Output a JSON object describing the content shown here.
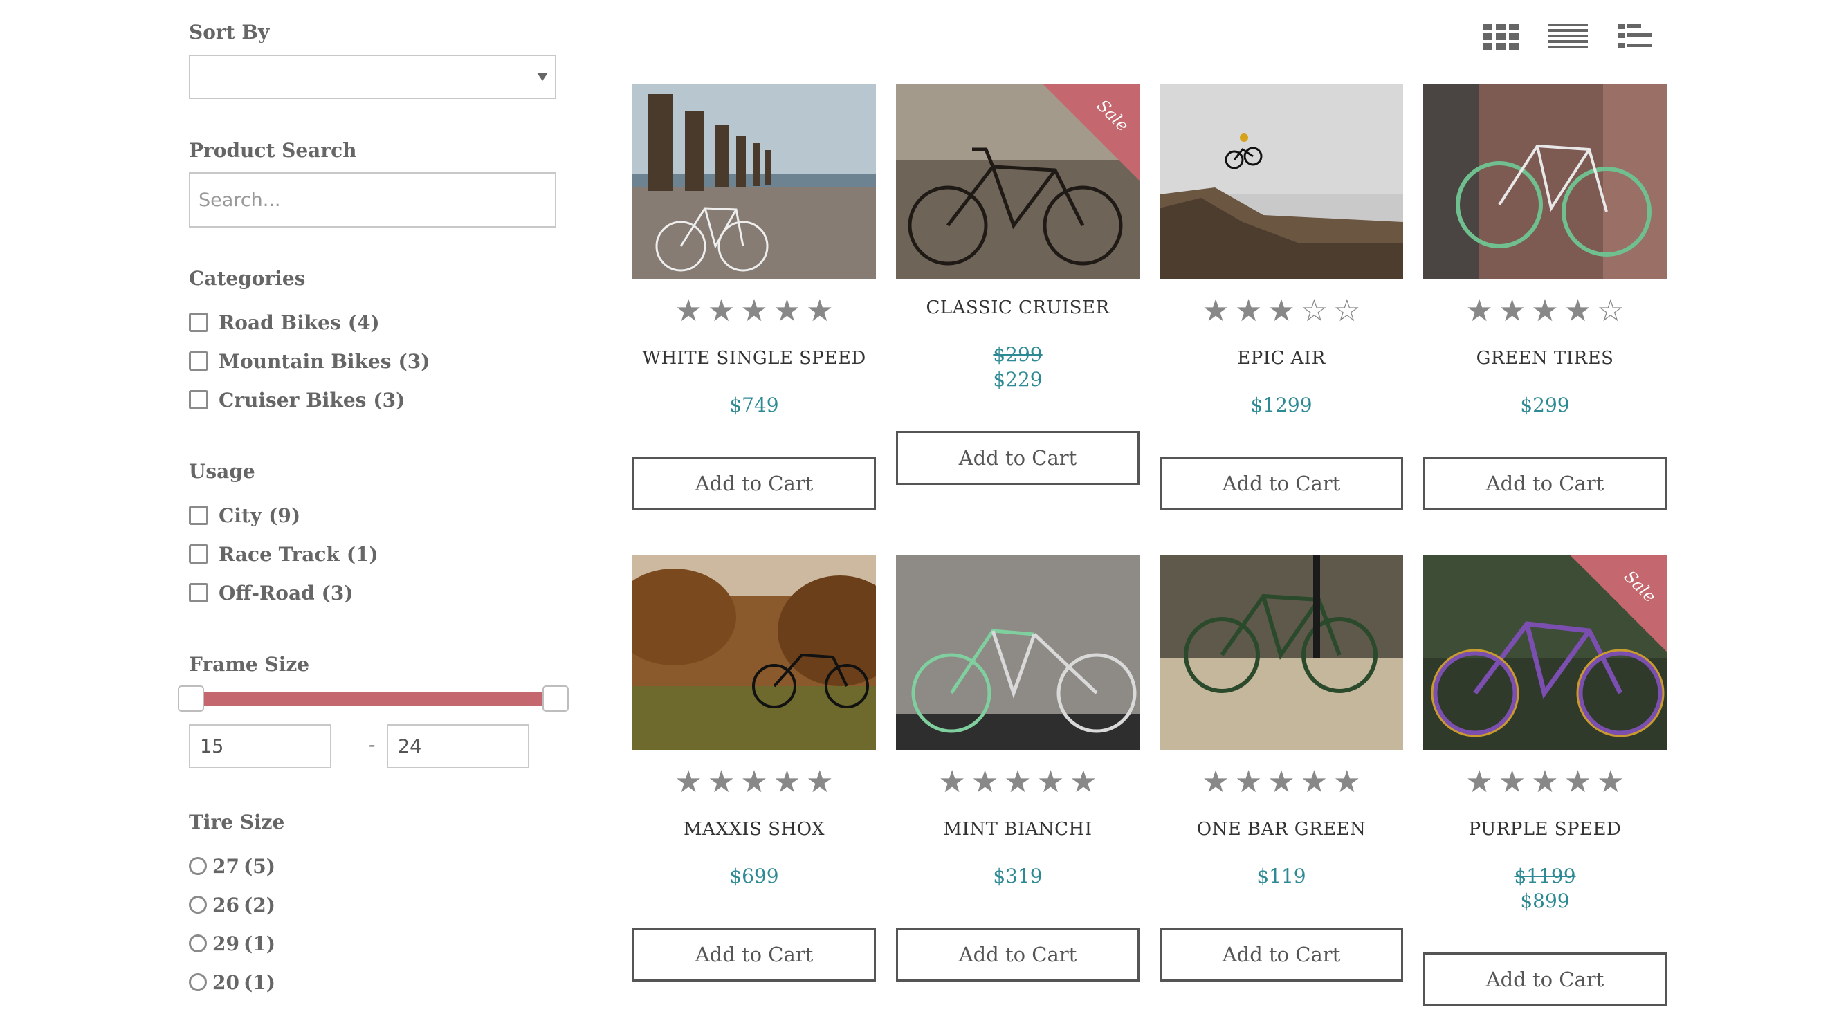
{
  "sidebar": {
    "sort_by": {
      "label": "Sort By",
      "value": ""
    },
    "product_search": {
      "label": "Product Search",
      "placeholder": "Search..."
    },
    "categories": {
      "label": "Categories",
      "items": [
        {
          "label": "Road Bikes",
          "count": "(4)"
        },
        {
          "label": "Mountain Bikes",
          "count": "(3)"
        },
        {
          "label": "Cruiser Bikes",
          "count": "(3)"
        }
      ]
    },
    "usage": {
      "label": "Usage",
      "items": [
        {
          "label": "City",
          "count": "(9)"
        },
        {
          "label": "Race Track",
          "count": "(1)"
        },
        {
          "label": "Off-Road",
          "count": "(3)"
        }
      ]
    },
    "frame_size": {
      "label": "Frame Size",
      "min": "15",
      "max": "24",
      "separator": "-"
    },
    "tire_size": {
      "label": "Tire Size",
      "items": [
        {
          "label": "27",
          "count": "(5)"
        },
        {
          "label": "26",
          "count": "(2)"
        },
        {
          "label": "29",
          "count": "(1)"
        },
        {
          "label": "20",
          "count": "(1)"
        }
      ]
    }
  },
  "toolbar": {
    "views": [
      {
        "icon": "grid-view-icon"
      },
      {
        "icon": "list-view-icon"
      },
      {
        "icon": "detail-list-view-icon"
      }
    ]
  },
  "products": [
    {
      "name": "WHITE SINGLE SPEED",
      "price": "$749",
      "rating": 5,
      "on_sale": false,
      "cart_label": "Add to Cart"
    },
    {
      "name": "CLASSIC CRUISER",
      "old_price": "$299",
      "price": "$229",
      "on_sale": true,
      "sale_label": "Sale",
      "cart_label": "Add to Cart"
    },
    {
      "name": "EPIC AIR",
      "price": "$1299",
      "rating": 3,
      "on_sale": false,
      "cart_label": "Add to Cart"
    },
    {
      "name": "GREEN TIRES",
      "price": "$299",
      "rating": 4,
      "on_sale": false,
      "cart_label": "Add to Cart"
    },
    {
      "name": "MAXXIS SHOX",
      "price": "$699",
      "rating": 5,
      "on_sale": false,
      "cart_label": "Add to Cart"
    },
    {
      "name": "MINT BIANCHI",
      "price": "$319",
      "rating": 5,
      "on_sale": false,
      "cart_label": "Add to Cart"
    },
    {
      "name": "ONE BAR GREEN",
      "price": "$119",
      "rating": 5,
      "on_sale": false,
      "cart_label": "Add to Cart"
    },
    {
      "name": "PURPLE SPEED",
      "old_price": "$1199",
      "price": "$899",
      "rating": 5,
      "on_sale": true,
      "sale_label": "Sale",
      "cart_label": "Add to Cart"
    }
  ],
  "colors": {
    "accent": "#c4676e",
    "price": "#2d8a94",
    "star": "#888888"
  }
}
